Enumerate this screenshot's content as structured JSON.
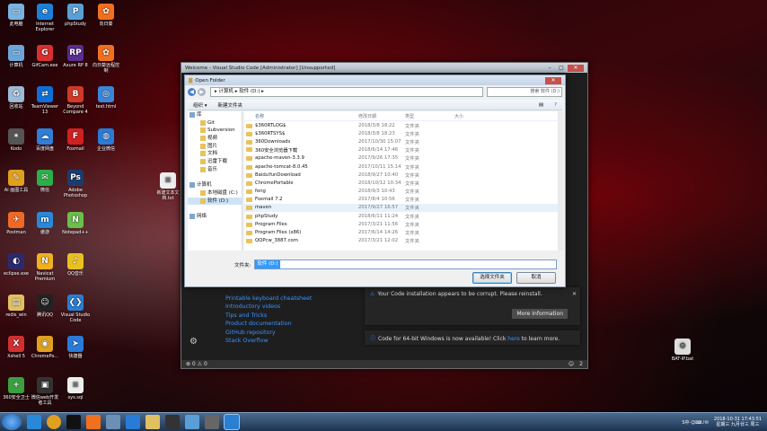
{
  "desktop": {
    "icons": [
      {
        "label": "此电脑",
        "color": "#7ab2e0"
      },
      {
        "label": "Internet Explorer",
        "color": "#1e7fd6"
      },
      {
        "label": "phpStudy",
        "color": "#5aa0d8"
      },
      {
        "label": "向日葵",
        "color": "#f07020"
      },
      {
        "label": "计算机",
        "color": "#6ca6d9"
      },
      {
        "label": "GifCam.exe",
        "color": "#d83030"
      },
      {
        "label": "Axure RP 8",
        "color": "#5a2d90"
      },
      {
        "label": "向日葵远程控制",
        "color": "#f07020"
      },
      {
        "label": "回收站",
        "color": "#9bbbd6"
      },
      {
        "label": "TeamViewer 13",
        "color": "#0e6fd6"
      },
      {
        "label": "Beyond Compare 4",
        "color": "#d03828"
      },
      {
        "label": "test.html",
        "color": "#3a86d8"
      },
      {
        "label": "Kodo",
        "color": "#555"
      },
      {
        "label": "百度网盘",
        "color": "#2f7fd8"
      },
      {
        "label": "Foxmail",
        "color": "#d02020"
      },
      {
        "label": "企业微信",
        "color": "#2a7bd8"
      },
      {
        "label": "Ai 画图工具",
        "color": "#e0a020"
      },
      {
        "label": "微信",
        "color": "#2ab048"
      },
      {
        "label": "Adobe Photoshop",
        "color": "#1b3d6e"
      },
      {
        "label": "新建文本文档.txt",
        "color": "#eee"
      },
      {
        "label": "Postman",
        "color": "#f06a26"
      },
      {
        "label": "傲游",
        "color": "#2a88d8"
      },
      {
        "label": "Notepad++",
        "color": "#6bbf4a"
      },
      {
        "label": "eclipse.exe",
        "color": "#2c2a6e"
      },
      {
        "label": "Navicat Premium",
        "color": "#f0b020"
      },
      {
        "label": "QQ音乐",
        "color": "#e8c020"
      },
      {
        "label": "redis_win",
        "color": "#e0c060"
      },
      {
        "label": "腾讯QQ",
        "color": "#222"
      },
      {
        "label": "Visual Studio Code",
        "color": "#2b7fd3"
      },
      {
        "label": "Xshell 5",
        "color": "#d03030"
      },
      {
        "label": "ChromePo...",
        "color": "#e0a020"
      },
      {
        "label": "快捷器",
        "color": "#2a7bd8"
      },
      {
        "label": "360安全卫士",
        "color": "#3aa040"
      },
      {
        "label": "微信web开发者工具",
        "color": "#333"
      },
      {
        "label": "sys.sql",
        "color": "#eee"
      },
      {
        "label": "BAT-IP.bat",
        "color": "#ddd"
      }
    ]
  },
  "vscode": {
    "title": "Welcome - Visual Studio Code [Administrator] [Unsupported]",
    "links": [
      "Printable keyboard cheatsheet",
      "Introductory videos",
      "Tips and Tricks",
      "Product documentation",
      "GitHub repository",
      "Stack Overflow"
    ],
    "notification1": "Your Code installation appears to be corrupt. Please reinstall.",
    "notification1_button": "More Information",
    "notification2_pre": "Code for 64-bit Windows is now available! Click ",
    "notification2_link": "here",
    "notification2_post": " to learn more.",
    "status_errors": "0",
    "status_warnings": "0",
    "status_label": "⊗ 0 ⚠ 0",
    "status_right": "2"
  },
  "dialog": {
    "title": "Open Folder",
    "breadcrumb": "▸ 计算机 ▸ 软件 (D:) ▸",
    "search_placeholder": "搜索 软件 (D:)",
    "toolbar": {
      "organize": "组织 ▾",
      "new_folder": "新建文件夹"
    },
    "nav": [
      {
        "label": "库",
        "level": 1
      },
      {
        "label": "Git",
        "level": 2
      },
      {
        "label": "Subversion",
        "level": 2
      },
      {
        "label": "视频",
        "level": 2
      },
      {
        "label": "图片",
        "level": 2
      },
      {
        "label": "文档",
        "level": 2
      },
      {
        "label": "迅雷下载",
        "level": 2
      },
      {
        "label": "音乐",
        "level": 2
      },
      {
        "label": "",
        "level": 1
      },
      {
        "label": "计算机",
        "level": 1
      },
      {
        "label": "本地磁盘 (C:)",
        "level": 2
      },
      {
        "label": "软件 (D:)",
        "level": 2,
        "selected": true
      },
      {
        "label": "",
        "level": 1
      },
      {
        "label": "网络",
        "level": 1
      }
    ],
    "columns": {
      "name": "名称",
      "date": "修改日期",
      "type": "类型",
      "size": "大小"
    },
    "files": [
      {
        "name": "$360RTLOG$",
        "date": "2018/3/8 18:22",
        "type": "文件夹"
      },
      {
        "name": "$360RTSYS$",
        "date": "2018/3/8 18:23",
        "type": "文件夹"
      },
      {
        "name": "360Downloads",
        "date": "2017/10/30 15:07",
        "type": "文件夹"
      },
      {
        "name": "360安全浏览器下载",
        "date": "2018/6/14 17:46",
        "type": "文件夹"
      },
      {
        "name": "apache-maven-3.3.9",
        "date": "2017/9/26 17:35",
        "type": "文件夹"
      },
      {
        "name": "apache-tomcat-8.0.45",
        "date": "2017/10/11 15:14",
        "type": "文件夹"
      },
      {
        "name": "BaiduYunDownload",
        "date": "2018/9/27 10:40",
        "type": "文件夹"
      },
      {
        "name": "ChromePortable",
        "date": "2018/10/12 10:34",
        "type": "文件夹"
      },
      {
        "name": "feng",
        "date": "2018/9/3 10:43",
        "type": "文件夹"
      },
      {
        "name": "Foxmail 7.2",
        "date": "2017/8/4 10:56",
        "type": "文件夹"
      },
      {
        "name": "maven",
        "date": "2017/9/27 16:57",
        "type": "文件夹",
        "hover": true
      },
      {
        "name": "phpStudy",
        "date": "2018/6/11 11:24",
        "type": "文件夹"
      },
      {
        "name": "Program Files",
        "date": "2017/3/21 11:56",
        "type": "文件夹"
      },
      {
        "name": "Program Files (x86)",
        "date": "2017/6/14 14:26",
        "type": "文件夹"
      },
      {
        "name": "QQPcw_3887.com",
        "date": "2017/3/21 12:02",
        "type": "文件夹"
      }
    ],
    "filename_label": "文件夹:",
    "filename_value": "软件 (D:)",
    "select_button": "选择文件夹",
    "cancel_button": "取消"
  },
  "taskbar": {
    "tray_text": "S中·☺⌨♪✉",
    "clock_time": "2018-10-31 17:43:51",
    "clock_date": "星期三 九月廿三 周三"
  }
}
